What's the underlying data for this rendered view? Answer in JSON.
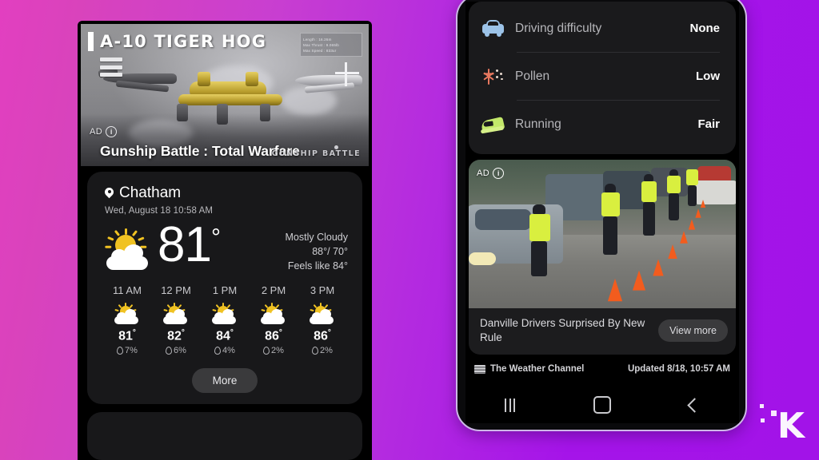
{
  "background": {
    "gradient_left": "#d943bc",
    "gradient_right": "#a213e8"
  },
  "left_phone": {
    "game_ad": {
      "title": "A-10 TIGER HOG",
      "specs": [
        "Length : 16.26m",
        "Max Thrust : 9.065lb",
        "Max Speed : 833ur"
      ],
      "ad_label": "AD",
      "info_glyph": "i",
      "game_name": "Gunship Battle : Total Warfare",
      "brand": "GUNSHIP BATTLE"
    },
    "weather_card": {
      "location": "Chatham",
      "datetime": "Wed, August 18 10:58 AM",
      "temperature": "81",
      "degree_symbol": "°",
      "condition": "Mostly Cloudy",
      "high_low": "88°/ 70°",
      "feels_like": "Feels like 84°",
      "icon": "partly-cloudy-icon",
      "hourly": [
        {
          "time": "11 AM",
          "temp": "81",
          "deg": "°",
          "precip": "7%",
          "icon": "partly-cloudy-icon"
        },
        {
          "time": "12 PM",
          "temp": "82",
          "deg": "°",
          "precip": "6%",
          "icon": "partly-cloudy-icon"
        },
        {
          "time": "1 PM",
          "temp": "84",
          "deg": "°",
          "precip": "4%",
          "icon": "partly-cloudy-icon"
        },
        {
          "time": "2 PM",
          "temp": "86",
          "deg": "°",
          "precip": "2%",
          "icon": "partly-cloudy-icon"
        },
        {
          "time": "3 PM",
          "temp": "86",
          "deg": "°",
          "precip": "2%",
          "icon": "partly-cloudy-icon"
        }
      ],
      "more_label": "More",
      "accent_sun": "#f0c222"
    }
  },
  "right_phone": {
    "activities": [
      {
        "label": "Driving difficulty",
        "value": "None",
        "icon": "car-icon",
        "icon_color": "#9cc3e8"
      },
      {
        "label": "Pollen",
        "value": "Low",
        "icon": "pollen-icon",
        "icon_color": "#e8785f"
      },
      {
        "label": "Running",
        "value": "Fair",
        "icon": "shoe-icon",
        "icon_color": "#c3e86a"
      }
    ],
    "news_ad": {
      "ad_label": "AD",
      "info_glyph": "i",
      "headline": "Danville Drivers Surprised By New Rule",
      "cta": "View more",
      "photo_alt": "police-checkpoint-photo"
    },
    "attribution": {
      "source": "The Weather Channel",
      "updated": "Updated 8/18, 10:57 AM"
    },
    "navbar": {
      "recents": "recents-button",
      "home": "home-button",
      "back": "back-button"
    }
  },
  "watermark": {
    "letter": "K"
  }
}
